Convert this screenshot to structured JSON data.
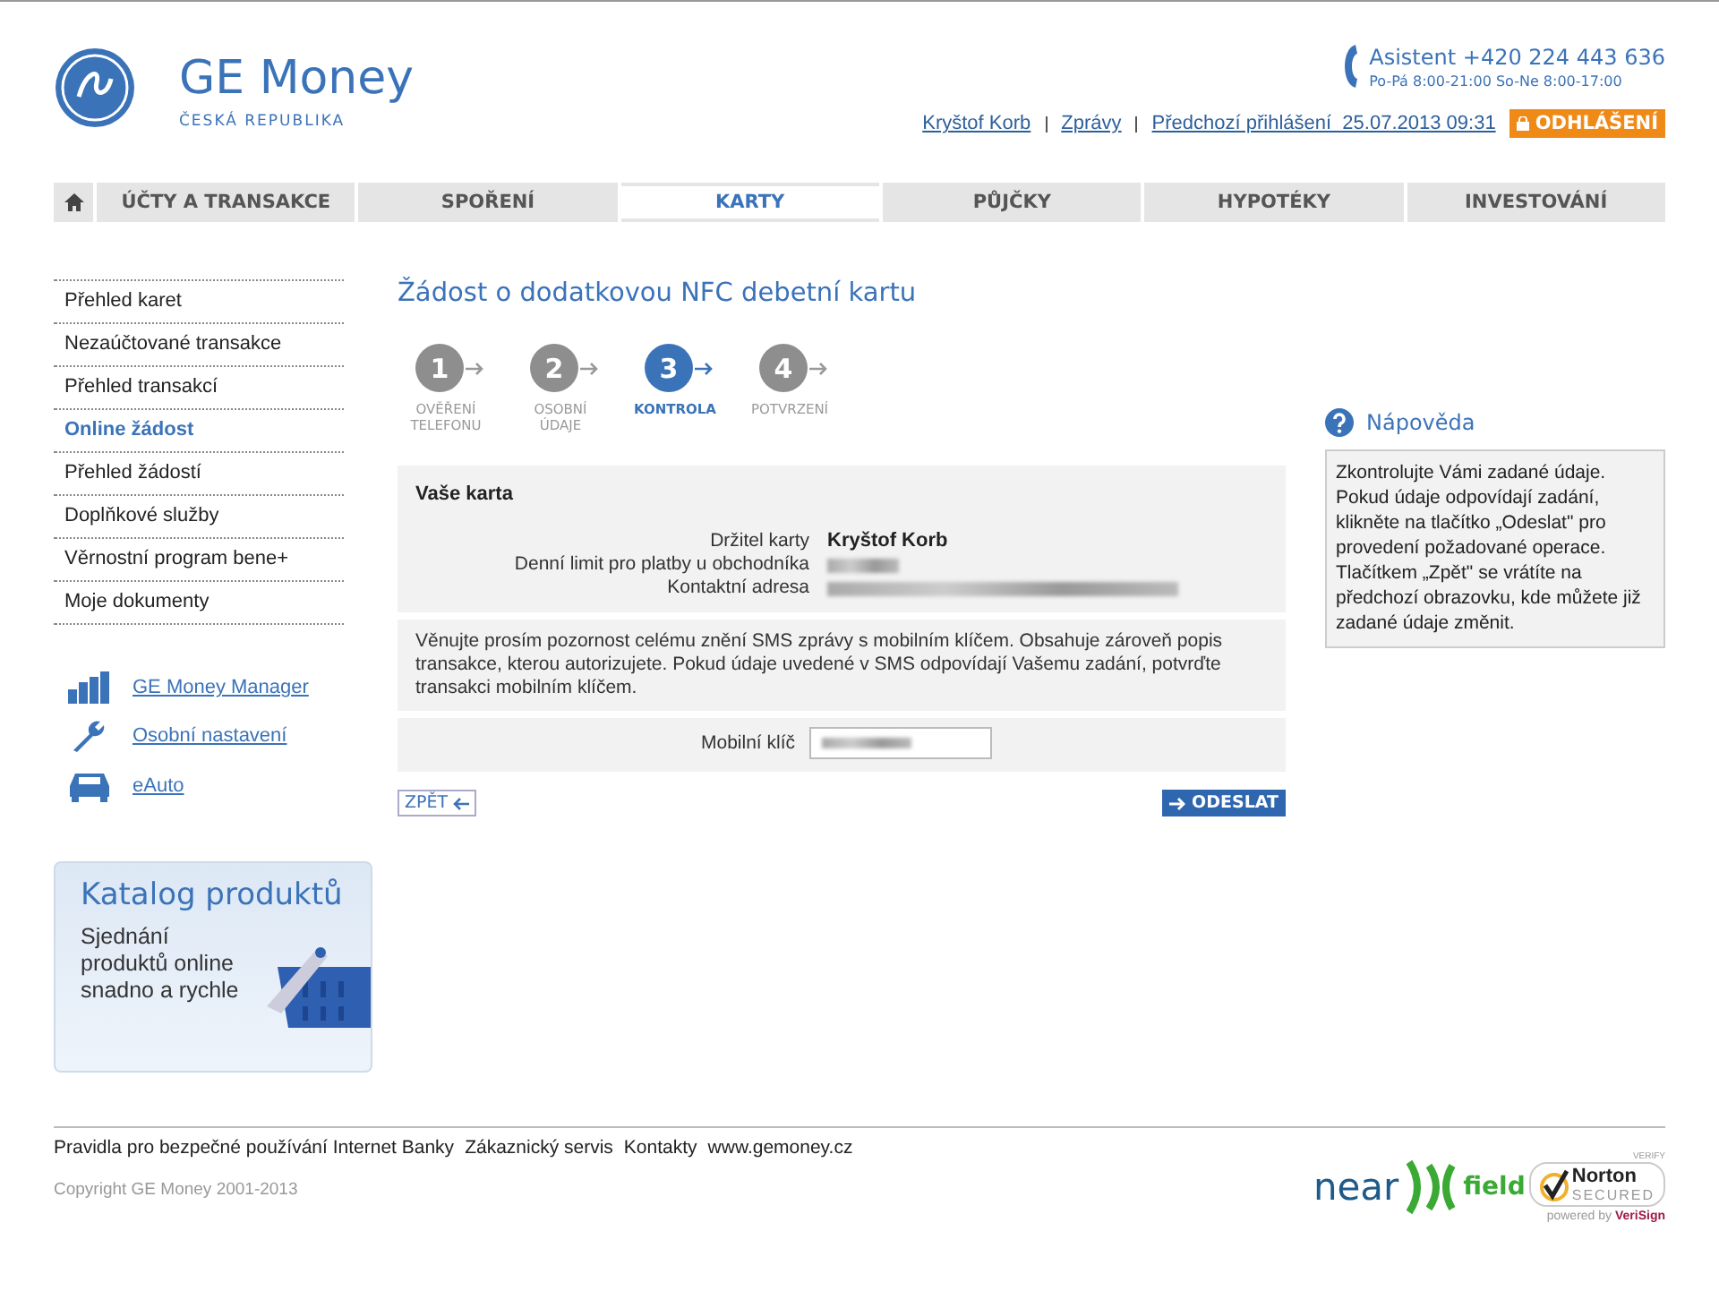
{
  "brand": {
    "name": "GE Money",
    "subtitle": "ČESKÁ REPUBLIKA"
  },
  "assistant": {
    "label": "Asistent +420 224 443 636",
    "hours": "Po-Pá 8:00-21:00 So-Ne 8:00-17:00"
  },
  "user_links": [
    "Kryštof Korb",
    "Zprávy",
    "Předchozí přihlášení  25.07.2013 09:31"
  ],
  "logout": "ODHLÁŠENÍ",
  "nav": [
    {
      "label": "ÚČTY A TRANSAKCE",
      "selected": false
    },
    {
      "label": "SPOŘENÍ",
      "selected": false
    },
    {
      "label": "KARTY",
      "selected": true
    },
    {
      "label": "PŮJČKY",
      "selected": false
    },
    {
      "label": "HYPOTÉKY",
      "selected": false
    },
    {
      "label": "INVESTOVÁNÍ",
      "selected": false
    }
  ],
  "sidebar": {
    "items": [
      {
        "label": "Přehled karet",
        "selected": false
      },
      {
        "label": "Nezaúčtované transakce",
        "selected": false
      },
      {
        "label": "Přehled transakcí",
        "selected": false
      },
      {
        "label": "Online žádost",
        "selected": true
      },
      {
        "label": "Přehled žádostí",
        "selected": false
      },
      {
        "label": "Doplňkové služby",
        "selected": false
      },
      {
        "label": "Věrnostní program bene+",
        "selected": false
      },
      {
        "label": "Moje dokumenty",
        "selected": false
      }
    ],
    "tools": [
      {
        "kind": "chart",
        "label": "GE Money Manager"
      },
      {
        "kind": "wrench",
        "label": "Osobní nastavení"
      },
      {
        "kind": "car",
        "label": "eAuto"
      }
    ],
    "promo": {
      "title": "Katalog produktů",
      "text": "Sjednání produktů online snadno a rychle"
    }
  },
  "page_title": "Žádost o dodatkovou NFC debetní kartu",
  "steps": [
    {
      "number": "1",
      "label": "OVĚŘENÍ TELEFONU",
      "selected": false
    },
    {
      "number": "2",
      "label": "OSOBNÍ ÚDAJE",
      "selected": false
    },
    {
      "number": "3",
      "label": "KONTROLA",
      "selected": true
    },
    {
      "number": "4",
      "label": "POTVRZENÍ",
      "selected": false
    }
  ],
  "card": {
    "title": "Vaše karta",
    "fields": [
      {
        "label": "Držitel karty",
        "value": "Kryštof Korb",
        "kind": "text"
      },
      {
        "label": "Denní limit pro platby u obchodníka",
        "kind": "blurred"
      },
      {
        "label": "Kontaktní adresa",
        "kind": "blurred"
      }
    ]
  },
  "notice": "Věnujte prosím pozornost celému znění SMS zprávy s mobilním klíčem. Obsahuje zároveň popis transakce, kterou autorizujete. Pokud údaje uvedené v SMS odpovídají Vašemu zadání, potvrďte transakci mobilním klíčem.",
  "mobile_key": {
    "label": "Mobilní klíč"
  },
  "back_button": "ZPĚT",
  "submit_button": "ODESLAT",
  "help": {
    "title": "Nápověda",
    "text": "Zkontrolujte Vámi zadané údaje. Pokud údaje odpovídají zadání, klikněte na tlačítko „Odeslat\" pro provedení požadované operace. Tlačítkem „Zpět\" se vrátíte na předchozí obrazovku, kde můžete již zadané údaje změnit."
  },
  "footer": {
    "links": [
      "Pravidla pro bezpečné používání Internet Banky",
      "Zákaznický servis",
      "Kontakty",
      "www.gemoney.cz"
    ],
    "copyright": "Copyright GE Money 2001-2013",
    "nfc_logo": [
      "near",
      "field"
    ],
    "norton": {
      "top": "VERIFY",
      "name": "Norton",
      "secured": "SECURED",
      "powered": "powered by",
      "verisign": "VeriSign"
    }
  }
}
